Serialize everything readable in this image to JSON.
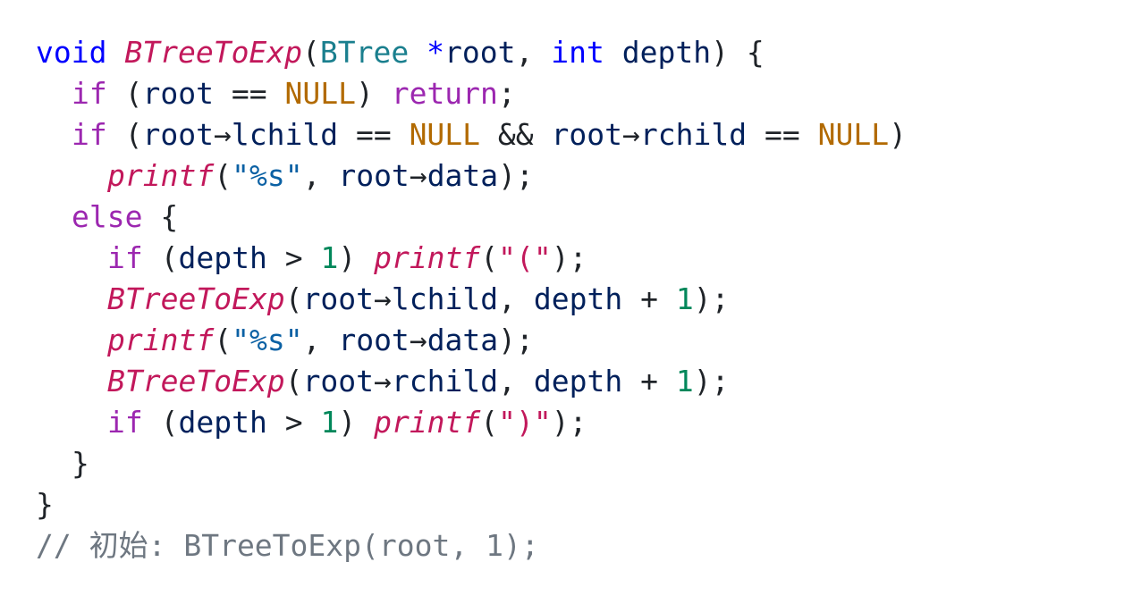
{
  "editor": {
    "lines": [
      {
        "indent": 0,
        "tokens": [
          {
            "t": "void",
            "k": "type"
          },
          {
            "t": " ",
            "k": "punc"
          },
          {
            "t": "BTreeToExp",
            "k": "func"
          },
          {
            "t": "(",
            "k": "punc"
          },
          {
            "t": "BTree",
            "k": "struct"
          },
          {
            "t": " ",
            "k": "punc"
          },
          {
            "t": "*",
            "k": "ptr"
          },
          {
            "t": "root",
            "k": "id"
          },
          {
            "t": ", ",
            "k": "punc"
          },
          {
            "t": "int",
            "k": "type"
          },
          {
            "t": " ",
            "k": "punc"
          },
          {
            "t": "depth",
            "k": "id"
          },
          {
            "t": ") {",
            "k": "punc"
          }
        ]
      },
      {
        "indent": 1,
        "tokens": [
          {
            "t": "if",
            "k": "kw"
          },
          {
            "t": " (",
            "k": "punc"
          },
          {
            "t": "root",
            "k": "id"
          },
          {
            "t": " == ",
            "k": "op"
          },
          {
            "t": "NULL",
            "k": "null"
          },
          {
            "t": ") ",
            "k": "punc"
          },
          {
            "t": "return",
            "k": "kw"
          },
          {
            "t": ";",
            "k": "punc"
          }
        ]
      },
      {
        "indent": 1,
        "tokens": [
          {
            "t": "if",
            "k": "kw"
          },
          {
            "t": " (",
            "k": "punc"
          },
          {
            "t": "root",
            "k": "id"
          },
          {
            "t": "→",
            "k": "op"
          },
          {
            "t": "lchild",
            "k": "id"
          },
          {
            "t": " == ",
            "k": "op"
          },
          {
            "t": "NULL",
            "k": "null"
          },
          {
            "t": " && ",
            "k": "op"
          },
          {
            "t": "root",
            "k": "id"
          },
          {
            "t": "→",
            "k": "op"
          },
          {
            "t": "rchild",
            "k": "id"
          },
          {
            "t": " == ",
            "k": "op"
          },
          {
            "t": "NULL",
            "k": "null"
          },
          {
            "t": ")",
            "k": "punc"
          }
        ]
      },
      {
        "indent": 2,
        "tokens": [
          {
            "t": "printf",
            "k": "func"
          },
          {
            "t": "(",
            "k": "punc"
          },
          {
            "t": "\"%s\"",
            "k": "str"
          },
          {
            "t": ", ",
            "k": "punc"
          },
          {
            "t": "root",
            "k": "id"
          },
          {
            "t": "→",
            "k": "op"
          },
          {
            "t": "data",
            "k": "id"
          },
          {
            "t": ");",
            "k": "punc"
          }
        ]
      },
      {
        "indent": 1,
        "tokens": [
          {
            "t": "else",
            "k": "kw"
          },
          {
            "t": " {",
            "k": "punc"
          }
        ]
      },
      {
        "indent": 2,
        "tokens": [
          {
            "t": "if",
            "k": "kw"
          },
          {
            "t": " (",
            "k": "punc"
          },
          {
            "t": "depth",
            "k": "id"
          },
          {
            "t": " > ",
            "k": "op"
          },
          {
            "t": "1",
            "k": "num"
          },
          {
            "t": ") ",
            "k": "punc"
          },
          {
            "t": "printf",
            "k": "func"
          },
          {
            "t": "(",
            "k": "punc"
          },
          {
            "t": "\"",
            "k": "strc"
          },
          {
            "t": "(",
            "k": "strc"
          },
          {
            "t": "\"",
            "k": "strc"
          },
          {
            "t": ");",
            "k": "punc"
          }
        ]
      },
      {
        "indent": 2,
        "tokens": [
          {
            "t": "BTreeToExp",
            "k": "func"
          },
          {
            "t": "(",
            "k": "punc"
          },
          {
            "t": "root",
            "k": "id"
          },
          {
            "t": "→",
            "k": "op"
          },
          {
            "t": "lchild",
            "k": "id"
          },
          {
            "t": ", ",
            "k": "punc"
          },
          {
            "t": "depth",
            "k": "id"
          },
          {
            "t": " + ",
            "k": "op"
          },
          {
            "t": "1",
            "k": "num"
          },
          {
            "t": ");",
            "k": "punc"
          }
        ]
      },
      {
        "indent": 2,
        "tokens": [
          {
            "t": "printf",
            "k": "func"
          },
          {
            "t": "(",
            "k": "punc"
          },
          {
            "t": "\"%s\"",
            "k": "str"
          },
          {
            "t": ", ",
            "k": "punc"
          },
          {
            "t": "root",
            "k": "id"
          },
          {
            "t": "→",
            "k": "op"
          },
          {
            "t": "data",
            "k": "id"
          },
          {
            "t": ");",
            "k": "punc"
          }
        ]
      },
      {
        "indent": 2,
        "tokens": [
          {
            "t": "BTreeToExp",
            "k": "func"
          },
          {
            "t": "(",
            "k": "punc"
          },
          {
            "t": "root",
            "k": "id"
          },
          {
            "t": "→",
            "k": "op"
          },
          {
            "t": "rchild",
            "k": "id"
          },
          {
            "t": ", ",
            "k": "punc"
          },
          {
            "t": "depth",
            "k": "id"
          },
          {
            "t": " + ",
            "k": "op"
          },
          {
            "t": "1",
            "k": "num"
          },
          {
            "t": ");",
            "k": "punc"
          }
        ]
      },
      {
        "indent": 2,
        "tokens": [
          {
            "t": "if",
            "k": "kw"
          },
          {
            "t": " (",
            "k": "punc"
          },
          {
            "t": "depth",
            "k": "id"
          },
          {
            "t": " > ",
            "k": "op"
          },
          {
            "t": "1",
            "k": "num"
          },
          {
            "t": ") ",
            "k": "punc"
          },
          {
            "t": "printf",
            "k": "func"
          },
          {
            "t": "(",
            "k": "punc"
          },
          {
            "t": "\"",
            "k": "strc"
          },
          {
            "t": ")",
            "k": "strc"
          },
          {
            "t": "\"",
            "k": "strc"
          },
          {
            "t": ");",
            "k": "punc"
          }
        ]
      },
      {
        "indent": 1,
        "tokens": [
          {
            "t": "}",
            "k": "punc"
          }
        ]
      },
      {
        "indent": 0,
        "tokens": [
          {
            "t": "}",
            "k": "punc"
          }
        ]
      },
      {
        "indent": 0,
        "tokens": [
          {
            "t": "// 初始: BTreeToExp(root, 1);",
            "k": "comment"
          }
        ]
      }
    ]
  }
}
